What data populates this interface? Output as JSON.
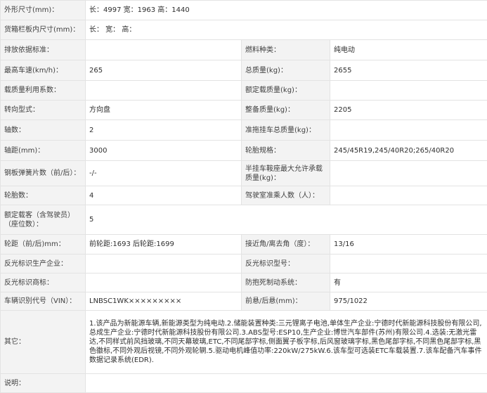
{
  "rows": {
    "r0": {
      "l": "外形尺寸(mm)：",
      "v": "长：4997 宽：1963 高：1440"
    },
    "r1": {
      "l": "货箱栏板内尺寸(mm)：",
      "v": "长： 宽： 高："
    },
    "r2": {
      "l1": "排放依据标准：",
      "v1": "",
      "l2": "燃料种类：",
      "v2": "纯电动"
    },
    "r3": {
      "l1": "最高车速(km/h)：",
      "v1": "265",
      "l2": "总质量(kg)：",
      "v2": "2655"
    },
    "r4": {
      "l1": "载质量利用系数：",
      "v1": "",
      "l2": "额定载质量(kg)：",
      "v2": ""
    },
    "r5": {
      "l1": "转向型式：",
      "v1": "方向盘",
      "l2": "整备质量(kg)：",
      "v2": "2205"
    },
    "r6": {
      "l1": "轴数：",
      "v1": "2",
      "l2": "准拖挂车总质量(kg)：",
      "v2": ""
    },
    "r7": {
      "l1": "轴距(mm)：",
      "v1": "3000",
      "l2": "轮胎规格：",
      "v2": "245/45R19,245/40R20;265/40R20"
    },
    "r8": {
      "l1": "钢板弹簧片数（前/后）：",
      "v1": "-/-",
      "l2": "半挂车鞍座最大允许承载质量(kg)：",
      "v2": ""
    },
    "r9": {
      "l1": "轮胎数：",
      "v1": "4",
      "l2": "驾驶室准乘人数（人）：",
      "v2": ""
    },
    "r10": {
      "l": "额定载客（含驾驶员）（座位数）：",
      "v": "5"
    },
    "r11": {
      "l1": "轮距（前/后)mm：",
      "v1": "前轮距:1693 后轮距:1699",
      "l2": "接近角/离去角（度）：",
      "v2": "13/16"
    },
    "r12": {
      "l1": "反光标识生产企业：",
      "v1": "",
      "l2": "反光标识型号：",
      "v2": ""
    },
    "r13": {
      "l1": "反光标识商标：",
      "v1": "",
      "l2": "防抱死制动系统：",
      "v2": "有"
    },
    "r14": {
      "l1": "车辆识别代号（VIN）：",
      "v1": "LNBSC1WK×××××××××",
      "l2": "前悬/后悬(mm)：",
      "v2": "975/1022"
    },
    "r15": {
      "l": "其它：",
      "v": "1.该产品为新能源车辆,新能源类型为纯电动.2.储能装置种类:三元锂离子电池,单体生产企业:宁德时代新能源科技股份有限公司,总成生产企业:宁德时代新能源科技股份有限公司.3.ABS型号:ESP10,生产企业:博世汽车部件(苏州)有限公司.4.选装:无激光雷达,不同样式前风挡玻璃,不同天幕玻璃,ETC,不同尾部字标,侧面翼子板字标,后风窗玻璃字标,黑色尾部字标,不同黑色尾部字标,黑色徽标,不同外观后视镜,不同外观轮辋.5.驱动电机峰值功率:220kW/275kW.6.该车型可选装ETC车载装置.7.该车配备汽车事件数据记录系统(EDR)."
    },
    "r16": {
      "l": "说明：",
      "v": ""
    }
  }
}
